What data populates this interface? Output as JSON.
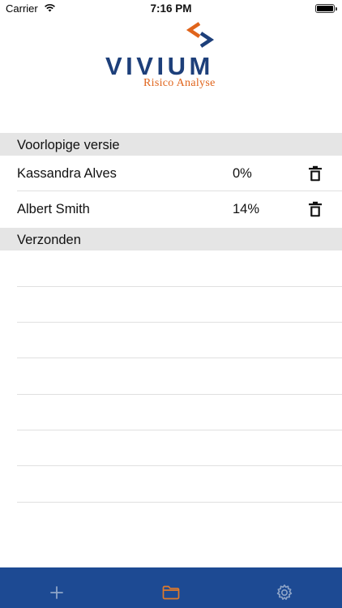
{
  "status_bar": {
    "carrier": "Carrier",
    "time": "7:16 PM"
  },
  "logo": {
    "word": "VIVIUM",
    "subtitle": "Risico Analyse",
    "colors": {
      "blue": "#1d3f7a",
      "orange": "#e0641b"
    }
  },
  "sections": {
    "draft": {
      "title": "Voorlopige versie",
      "rows": [
        {
          "name": "Kassandra Alves",
          "progress": "0%"
        },
        {
          "name": "Albert Smith",
          "progress": "14%"
        }
      ]
    },
    "sent": {
      "title": "Verzonden"
    }
  },
  "tab_bar": {
    "background": "#1d4a93",
    "active_color": "#e07a2a",
    "inactive_color": "#8fa5c8",
    "tabs": [
      {
        "icon": "plus-icon",
        "active": false
      },
      {
        "icon": "folder-icon",
        "active": true
      },
      {
        "icon": "gear-icon",
        "active": false
      }
    ]
  }
}
